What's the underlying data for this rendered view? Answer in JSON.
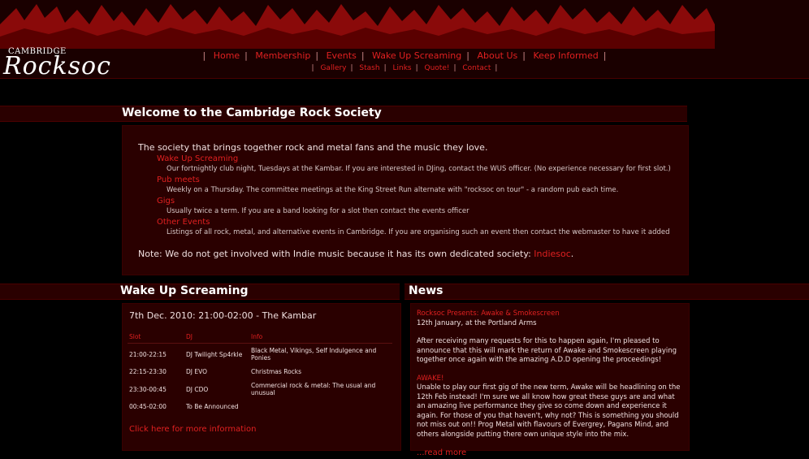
{
  "logo": {
    "small": "CAMBRIDGE",
    "big": "Rocksoc"
  },
  "nav_primary": [
    "Home",
    "Membership",
    "Events",
    "Wake Up Screaming",
    "About Us",
    "Keep Informed"
  ],
  "nav_secondary": [
    "Gallery",
    "Stash",
    "Links",
    "Quote!",
    "Contact"
  ],
  "welcome": {
    "title": "Welcome to the Cambridge Rock Society",
    "intro": "The society that brings together rock and metal fans and the music they love.",
    "items": [
      {
        "label": "Wake Up Screaming",
        "desc": "Our fortnightly club night, Tuesdays at the Kambar. If you are interested in DJing, contact the WUS officer. (No experience necessary for first slot.)"
      },
      {
        "label": "Pub meets",
        "desc": "Weekly on a Thursday. The committee meetings at the King Street Run alternate with \"rocksoc on tour\" - a random pub each time."
      },
      {
        "label": "Gigs",
        "desc": "Usually twice a term. If you are a band looking for a slot then contact the events officer"
      },
      {
        "label": "Other Events",
        "desc": "Listings of all rock, metal, and alternative events in Cambridge. If you are organising such an event then contact the webmaster to have it added"
      }
    ],
    "note_text": "Note: We do not get involved with Indie music because it has its own dedicated society: ",
    "note_link": "Indiesoc",
    "note_end": "."
  },
  "wus": {
    "title": "Wake Up Screaming",
    "date": "7th Dec. 2010: 21:00-02:00 - The Kambar",
    "headers": [
      "Slot",
      "DJ",
      "Info"
    ],
    "rows": [
      [
        "21:00-22:15",
        "DJ Twilight Sp4rkle",
        "Black Metal, Vikings, Self Indulgence and Ponies"
      ],
      [
        "22:15-23:30",
        "DJ EVO",
        "Christmas Rocks"
      ],
      [
        "23:30-00:45",
        "DJ CDO",
        "Commercial rock & metal: The usual and unusual"
      ],
      [
        "00:45-02:00",
        "To Be Announced",
        ""
      ]
    ],
    "more_link": "Click here for more information"
  },
  "news": {
    "title": "News",
    "item1_title": "Rocksoc Presents: Awake & Smokescreen",
    "item1_date": "12th January, at the Portland Arms",
    "item1_body": "After receiving many requests for this to happen again, I'm pleased to announce that this will mark the return of Awake and Smokescreen playing together once again with the amazing A.D.D opening the proceedings!",
    "item2_title": "AWAKE!",
    "item2_body": "Unable to play our first gig of the new term, Awake will be headlining on the 12th Feb instead! I'm sure we all know how great these guys are and what an amazing live performance they give so come down and experience it again. For those of you that haven't, why not? This is something you should not miss out on!! Prog Metal with flavours of Evergrey, Pagans Mind, and others alongside putting there own unique style into the mix.",
    "read_more": "...read more"
  },
  "colors": {
    "accent": "#e02020",
    "panel": "#2a0000",
    "background": "#000000",
    "header": "#1a0000"
  }
}
